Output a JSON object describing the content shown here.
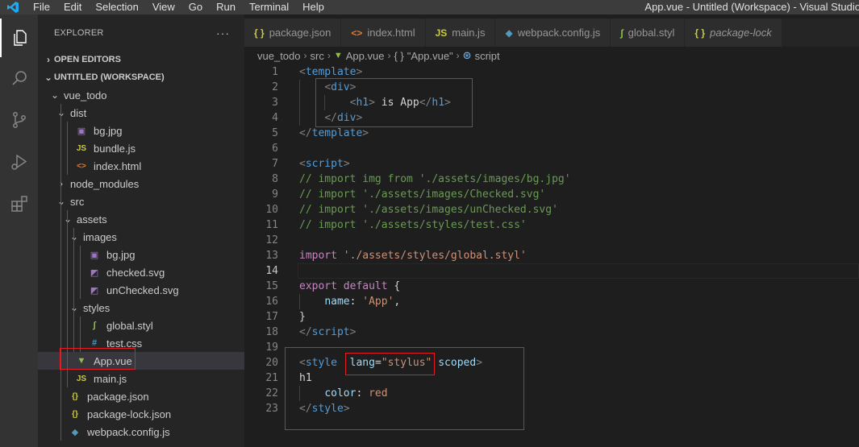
{
  "menu": {
    "items": [
      "File",
      "Edit",
      "Selection",
      "View",
      "Go",
      "Run",
      "Terminal",
      "Help"
    ],
    "window_title": "App.vue - Untitled (Workspace) - Visual Studio"
  },
  "sidebar": {
    "title": "EXPLORER",
    "more": "···",
    "open_editors": "OPEN EDITORS",
    "workspace": "UNTITLED (WORKSPACE)",
    "tree": [
      {
        "label": "vue_todo",
        "type": "folder-open",
        "depth": 0
      },
      {
        "label": "dist",
        "type": "folder-open",
        "depth": 1
      },
      {
        "label": "bg.jpg",
        "type": "image",
        "depth": 2
      },
      {
        "label": "bundle.js",
        "type": "js",
        "depth": 2
      },
      {
        "label": "index.html",
        "type": "html",
        "depth": 2
      },
      {
        "label": "node_modules",
        "type": "folder-closed",
        "depth": 1
      },
      {
        "label": "src",
        "type": "folder-open",
        "depth": 1
      },
      {
        "label": "assets",
        "type": "folder-open",
        "depth": 2
      },
      {
        "label": "images",
        "type": "folder-open",
        "depth": 3
      },
      {
        "label": "bg.jpg",
        "type": "image",
        "depth": 4
      },
      {
        "label": "checked.svg",
        "type": "svg",
        "depth": 4
      },
      {
        "label": "unChecked.svg",
        "type": "svg",
        "depth": 4
      },
      {
        "label": "styles",
        "type": "folder-open",
        "depth": 3
      },
      {
        "label": "global.styl",
        "type": "styl",
        "depth": 4
      },
      {
        "label": "test.css",
        "type": "css",
        "depth": 4
      },
      {
        "label": "App.vue",
        "type": "vue",
        "depth": 2,
        "selected": true
      },
      {
        "label": "main.js",
        "type": "js",
        "depth": 2
      },
      {
        "label": "package.json",
        "type": "json",
        "depth": 1
      },
      {
        "label": "package-lock.json",
        "type": "json",
        "depth": 1
      },
      {
        "label": "webpack.config.js",
        "type": "webpack",
        "depth": 1
      }
    ]
  },
  "tabs": [
    {
      "label": "package.json",
      "icon": "{ }",
      "color": "#cbcb41"
    },
    {
      "label": "index.html",
      "icon": "<>",
      "color": "#e37933"
    },
    {
      "label": "main.js",
      "icon": "JS",
      "color": "#cbcb41"
    },
    {
      "label": "webpack.config.js",
      "icon": "◆",
      "color": "#519aba"
    },
    {
      "label": "global.styl",
      "icon": "∫",
      "color": "#8dc149"
    },
    {
      "label": "package-lock",
      "icon": "{ }",
      "color": "#cbcb41",
      "italic": true
    }
  ],
  "breadcrumb": {
    "parts": [
      "vue_todo",
      "src",
      "App.vue",
      "\"App.vue\"",
      "script"
    ],
    "sep": "›"
  },
  "code_lines": [
    [
      [
        "c-br",
        "<"
      ],
      [
        "c-tag",
        "template"
      ],
      [
        "c-br",
        ">"
      ]
    ],
    [
      [
        "c-txt",
        "    "
      ],
      [
        "c-br",
        "<"
      ],
      [
        "c-tag",
        "div"
      ],
      [
        "c-br",
        ">"
      ]
    ],
    [
      [
        "c-txt",
        "        "
      ],
      [
        "c-br",
        "<"
      ],
      [
        "c-tag",
        "h1"
      ],
      [
        "c-br",
        ">"
      ],
      [
        "c-txt",
        " is App"
      ],
      [
        "c-br",
        "</"
      ],
      [
        "c-tag",
        "h1"
      ],
      [
        "c-br",
        ">"
      ]
    ],
    [
      [
        "c-txt",
        "    "
      ],
      [
        "c-br",
        "</"
      ],
      [
        "c-tag",
        "div"
      ],
      [
        "c-br",
        ">"
      ]
    ],
    [
      [
        "c-br",
        "</"
      ],
      [
        "c-tag",
        "template"
      ],
      [
        "c-br",
        ">"
      ]
    ],
    [],
    [
      [
        "c-br",
        "<"
      ],
      [
        "c-tag",
        "script"
      ],
      [
        "c-br",
        ">"
      ]
    ],
    [
      [
        "c-com",
        "// import img from './assets/images/bg.jpg'"
      ]
    ],
    [
      [
        "c-com",
        "// import './assets/images/Checked.svg'"
      ]
    ],
    [
      [
        "c-com",
        "// import './assets/images/unChecked.svg'"
      ]
    ],
    [
      [
        "c-com",
        "// import './assets/styles/test.css'"
      ]
    ],
    [],
    [
      [
        "c-kw",
        "import"
      ],
      [
        "c-txt",
        " "
      ],
      [
        "c-str",
        "'./assets/styles/global.styl'"
      ]
    ],
    [],
    [
      [
        "c-kw",
        "export"
      ],
      [
        "c-txt",
        " "
      ],
      [
        "c-kw",
        "default"
      ],
      [
        "c-txt",
        " {"
      ]
    ],
    [
      [
        "c-txt",
        "    "
      ],
      [
        "c-key",
        "name"
      ],
      [
        "c-txt",
        ": "
      ],
      [
        "c-str",
        "'App'"
      ],
      [
        "c-txt",
        ","
      ]
    ],
    [
      [
        "c-txt",
        "}"
      ]
    ],
    [
      [
        "c-br",
        "</"
      ],
      [
        "c-tag",
        "script"
      ],
      [
        "c-br",
        ">"
      ]
    ],
    [],
    [
      [
        "c-br",
        "<"
      ],
      [
        "c-tag",
        "style"
      ],
      [
        "c-txt",
        "  "
      ],
      [
        "c-key",
        "lang"
      ],
      [
        "c-txt",
        "="
      ],
      [
        "c-str",
        "\"stylus\""
      ],
      [
        "c-txt",
        " "
      ],
      [
        "c-key",
        "scoped"
      ],
      [
        "c-br",
        ">"
      ]
    ],
    [
      [
        "c-txt",
        "h1"
      ]
    ],
    [
      [
        "c-txt",
        "    "
      ],
      [
        "c-key",
        "color"
      ],
      [
        "c-txt",
        ": "
      ],
      [
        "c-str",
        "red"
      ]
    ],
    [
      [
        "c-br",
        "</"
      ],
      [
        "c-tag",
        "style"
      ],
      [
        "c-br",
        ">"
      ]
    ]
  ],
  "current_line": 14,
  "colors": {
    "highlight_box": "#e51c23",
    "accent": "#007acc"
  }
}
